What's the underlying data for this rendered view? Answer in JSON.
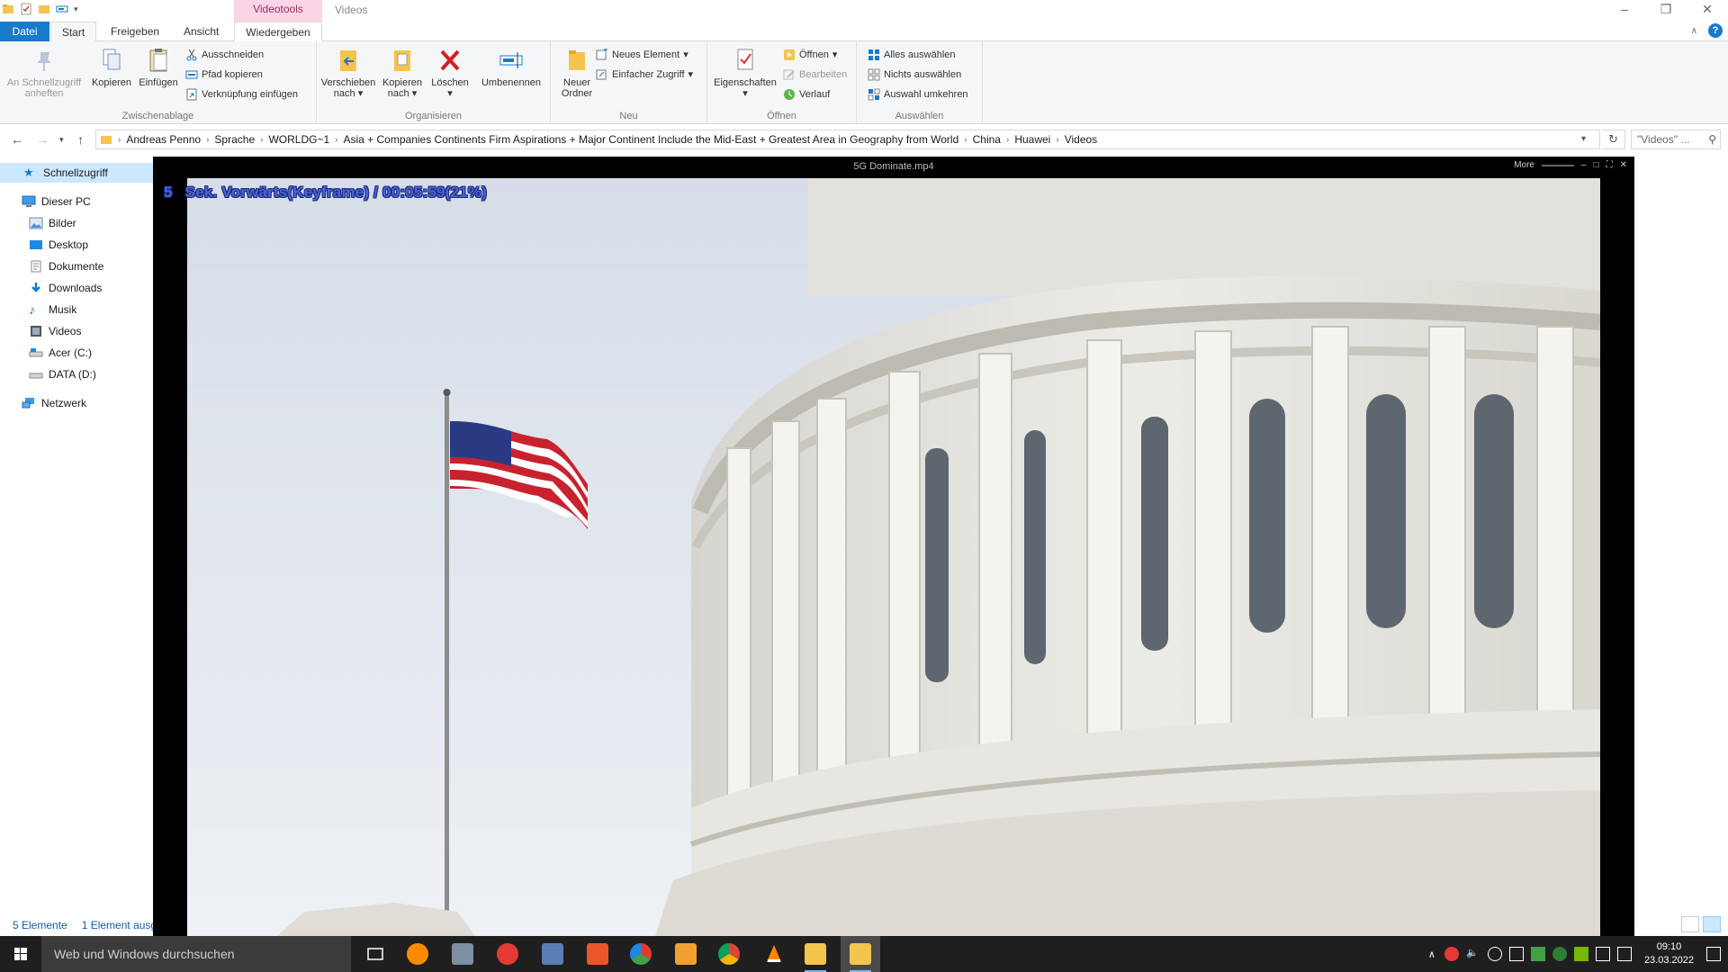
{
  "window": {
    "title": "Videos",
    "context_tab": "Videotools"
  },
  "tabs": {
    "file": "Datei",
    "start": "Start",
    "share": "Freigeben",
    "view": "Ansicht",
    "play": "Wiedergeben"
  },
  "ribbon": {
    "clipboard": {
      "label": "Zwischenablage",
      "pin": "An Schnellzugriff anheften",
      "copy": "Kopieren",
      "paste": "Einfügen",
      "cut": "Ausschneiden",
      "copy_path": "Pfad kopieren",
      "paste_shortcut": "Verknüpfung einfügen"
    },
    "organize": {
      "label": "Organisieren",
      "move_to": "Verschieben nach",
      "copy_to": "Kopieren nach",
      "delete": "Löschen",
      "rename": "Umbenennen"
    },
    "new": {
      "label": "Neu",
      "new_folder": "Neuer Ordner",
      "new_item": "Neues Element",
      "easy_access": "Einfacher Zugriff"
    },
    "open": {
      "label": "Öffnen",
      "properties": "Eigenschaften",
      "open": "Öffnen",
      "edit": "Bearbeiten",
      "history": "Verlauf"
    },
    "select": {
      "label": "Auswählen",
      "select_all": "Alles auswählen",
      "select_none": "Nichts auswählen",
      "invert": "Auswahl umkehren"
    }
  },
  "address": {
    "crumbs": [
      "Andreas Penno",
      "Sprache",
      "WORLDG~1",
      "Asia + Companies  Continents Firm Aspirations + Major Continent Include the Mid-East + Greatest Area in Geography from World",
      "China",
      "Huawei",
      "Videos"
    ],
    "search_placeholder": "\"Videos\" ..."
  },
  "navigation": {
    "quick_access": "Schnellzugriff",
    "this_pc": "Dieser PC",
    "items": [
      "Bilder",
      "Desktop",
      "Dokumente",
      "Downloads",
      "Musik",
      "Videos",
      "Acer (C:)",
      "DATA (D:)"
    ],
    "network": "Netzwerk"
  },
  "status": {
    "count": "5 Elemente",
    "selected": "1 Element ausg"
  },
  "player": {
    "title": "5G Dominate.mp4",
    "more": "More",
    "osd_number": "5",
    "osd_text": "Sek. Vorwärts(Keyframe) / 00:05:59(21%)"
  },
  "taskbar": {
    "search_placeholder": "Web und Windows durchsuchen",
    "time": "09:10",
    "date": "23.03.2022"
  },
  "colors": {
    "accent": "#1979ca",
    "context_tab_bg": "#fbd5e6",
    "osd": "#4a63d8"
  }
}
